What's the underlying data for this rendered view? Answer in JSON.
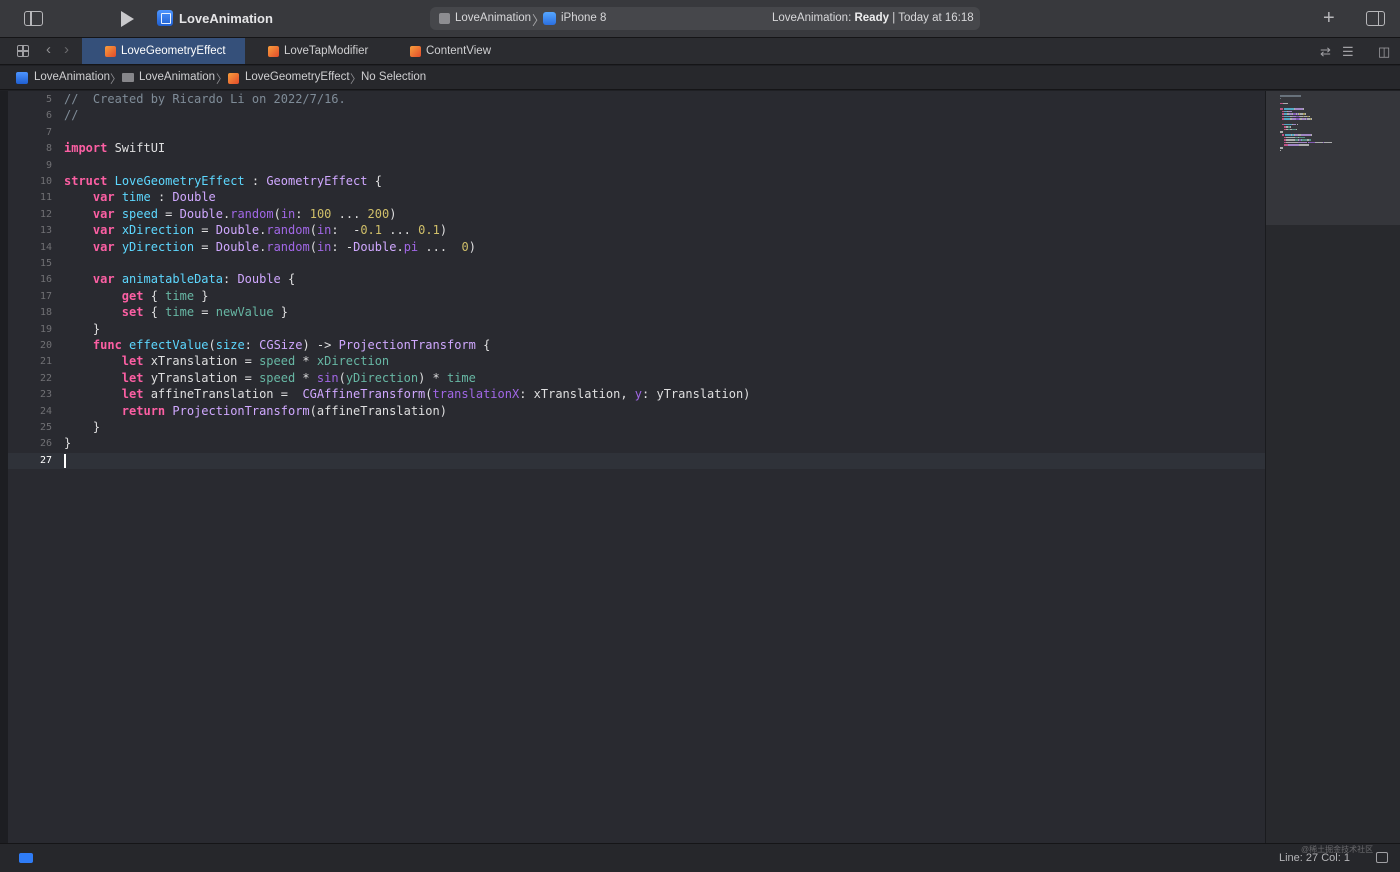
{
  "toolbar": {
    "project_title": "LoveAnimation",
    "scheme": "LoveAnimation",
    "device": "iPhone 8",
    "status_project": "LoveAnimation:",
    "status_state": "Ready",
    "status_time": "| Today at 16:18",
    "add_label": "+"
  },
  "tabs": [
    {
      "label": "LoveGeometryEffect",
      "active": true
    },
    {
      "label": "LoveTapModifier",
      "active": false
    },
    {
      "label": "ContentView",
      "active": false
    }
  ],
  "jumpbar": {
    "project": "LoveAnimation",
    "group": "LoveAnimation",
    "file": "LoveGeometryEffect",
    "selection": "No Selection"
  },
  "editor": {
    "current_line": "27",
    "lines": [
      {
        "n": "5",
        "tokens": [
          [
            "cm",
            "//  Created by Ricardo Li on 2022/7/16."
          ]
        ]
      },
      {
        "n": "6",
        "tokens": [
          [
            "cm",
            "//"
          ]
        ]
      },
      {
        "n": "7",
        "tokens": []
      },
      {
        "n": "8",
        "tokens": [
          [
            "kw",
            "import"
          ],
          [
            "pl",
            " SwiftUI"
          ]
        ]
      },
      {
        "n": "9",
        "tokens": []
      },
      {
        "n": "10",
        "tokens": [
          [
            "kw",
            "struct"
          ],
          [
            "pl",
            " "
          ],
          [
            "df",
            "LoveGeometryEffect"
          ],
          [
            "pl",
            " : "
          ],
          [
            "ty",
            "GeometryEffect"
          ],
          [
            "pl",
            " {"
          ]
        ]
      },
      {
        "n": "11",
        "tokens": [
          [
            "pl",
            "    "
          ],
          [
            "kw",
            "var"
          ],
          [
            "pl",
            " "
          ],
          [
            "df",
            "time"
          ],
          [
            "pl",
            " : "
          ],
          [
            "ty",
            "Double"
          ]
        ]
      },
      {
        "n": "12",
        "tokens": [
          [
            "pl",
            "    "
          ],
          [
            "kw",
            "var"
          ],
          [
            "pl",
            " "
          ],
          [
            "df",
            "speed"
          ],
          [
            "pl",
            " = "
          ],
          [
            "ty",
            "Double"
          ],
          [
            "pl",
            "."
          ],
          [
            "fn",
            "random"
          ],
          [
            "pl",
            "("
          ],
          [
            "fn",
            "in"
          ],
          [
            "pl",
            ": "
          ],
          [
            "nm",
            "100"
          ],
          [
            "pl",
            " ... "
          ],
          [
            "nm",
            "200"
          ],
          [
            "pl",
            ")"
          ]
        ]
      },
      {
        "n": "13",
        "tokens": [
          [
            "pl",
            "    "
          ],
          [
            "kw",
            "var"
          ],
          [
            "pl",
            " "
          ],
          [
            "df",
            "xDirection"
          ],
          [
            "pl",
            " = "
          ],
          [
            "ty",
            "Double"
          ],
          [
            "pl",
            "."
          ],
          [
            "fn",
            "random"
          ],
          [
            "pl",
            "("
          ],
          [
            "fn",
            "in"
          ],
          [
            "pl",
            ":  -"
          ],
          [
            "nm",
            "0.1"
          ],
          [
            "pl",
            " ... "
          ],
          [
            "nm",
            "0.1"
          ],
          [
            "pl",
            ")"
          ]
        ]
      },
      {
        "n": "14",
        "tokens": [
          [
            "pl",
            "    "
          ],
          [
            "kw",
            "var"
          ],
          [
            "pl",
            " "
          ],
          [
            "df",
            "yDirection"
          ],
          [
            "pl",
            " = "
          ],
          [
            "ty",
            "Double"
          ],
          [
            "pl",
            "."
          ],
          [
            "fn",
            "random"
          ],
          [
            "pl",
            "("
          ],
          [
            "fn",
            "in"
          ],
          [
            "pl",
            ": -"
          ],
          [
            "ty",
            "Double"
          ],
          [
            "pl",
            "."
          ],
          [
            "fn",
            "pi"
          ],
          [
            "pl",
            " ...  "
          ],
          [
            "nm",
            "0"
          ],
          [
            "pl",
            ")"
          ]
        ]
      },
      {
        "n": "15",
        "tokens": []
      },
      {
        "n": "16",
        "tokens": [
          [
            "pl",
            "    "
          ],
          [
            "kw",
            "var"
          ],
          [
            "pl",
            " "
          ],
          [
            "df",
            "animatableData"
          ],
          [
            "pl",
            ": "
          ],
          [
            "ty",
            "Double"
          ],
          [
            "pl",
            " {"
          ]
        ]
      },
      {
        "n": "17",
        "tokens": [
          [
            "pl",
            "        "
          ],
          [
            "kw",
            "get"
          ],
          [
            "pl",
            " { "
          ],
          [
            "pr",
            "time"
          ],
          [
            "pl",
            " }"
          ]
        ]
      },
      {
        "n": "18",
        "tokens": [
          [
            "pl",
            "        "
          ],
          [
            "kw",
            "set"
          ],
          [
            "pl",
            " { "
          ],
          [
            "pr",
            "time"
          ],
          [
            "pl",
            " = "
          ],
          [
            "pr",
            "newValue"
          ],
          [
            "pl",
            " }"
          ]
        ]
      },
      {
        "n": "19",
        "tokens": [
          [
            "pl",
            "    }"
          ]
        ]
      },
      {
        "n": "20",
        "tokens": [
          [
            "pl",
            "    "
          ],
          [
            "kw",
            "func"
          ],
          [
            "pl",
            " "
          ],
          [
            "df",
            "effectValue"
          ],
          [
            "pl",
            "("
          ],
          [
            "df",
            "size"
          ],
          [
            "pl",
            ": "
          ],
          [
            "ty",
            "CGSize"
          ],
          [
            "pl",
            ") -> "
          ],
          [
            "ty",
            "ProjectionTransform"
          ],
          [
            "pl",
            " {"
          ]
        ]
      },
      {
        "n": "21",
        "tokens": [
          [
            "pl",
            "        "
          ],
          [
            "kw",
            "let"
          ],
          [
            "pl",
            " xTranslation = "
          ],
          [
            "pr",
            "speed"
          ],
          [
            "pl",
            " * "
          ],
          [
            "pr",
            "xDirection"
          ]
        ]
      },
      {
        "n": "22",
        "tokens": [
          [
            "pl",
            "        "
          ],
          [
            "kw",
            "let"
          ],
          [
            "pl",
            " yTranslation = "
          ],
          [
            "pr",
            "speed"
          ],
          [
            "pl",
            " * "
          ],
          [
            "fn",
            "sin"
          ],
          [
            "pl",
            "("
          ],
          [
            "pr",
            "yDirection"
          ],
          [
            "pl",
            ") * "
          ],
          [
            "pr",
            "time"
          ]
        ]
      },
      {
        "n": "23",
        "tokens": [
          [
            "pl",
            "        "
          ],
          [
            "kw",
            "let"
          ],
          [
            "pl",
            " affineTranslation =  "
          ],
          [
            "ty",
            "CGAffineTransform"
          ],
          [
            "pl",
            "("
          ],
          [
            "fn",
            "translationX"
          ],
          [
            "pl",
            ": xTranslation, "
          ],
          [
            "fn",
            "y"
          ],
          [
            "pl",
            ": yTranslation)"
          ]
        ]
      },
      {
        "n": "24",
        "tokens": [
          [
            "pl",
            "        "
          ],
          [
            "kw",
            "return"
          ],
          [
            "pl",
            " "
          ],
          [
            "ty",
            "ProjectionTransform"
          ],
          [
            "pl",
            "(affineTranslation)"
          ]
        ]
      },
      {
        "n": "25",
        "tokens": [
          [
            "pl",
            "    }"
          ]
        ]
      },
      {
        "n": "26",
        "tokens": [
          [
            "pl",
            "}"
          ]
        ]
      },
      {
        "n": "27",
        "tokens": []
      }
    ]
  },
  "statusbar": {
    "position": "Line: 27  Col: 1",
    "watermark": "@稀土掘金技术社区"
  },
  "colors": {
    "keyword": "#fc5fa3",
    "comment": "#7f8c98",
    "type": "#d0a8ff",
    "property": "#67b7a4",
    "number": "#d0bf69",
    "declaration": "#5dd8ff",
    "function": "#a167e6",
    "plain": "#dfdfe0",
    "active_tab": "#35507a",
    "editor_bg": "#292a30"
  }
}
